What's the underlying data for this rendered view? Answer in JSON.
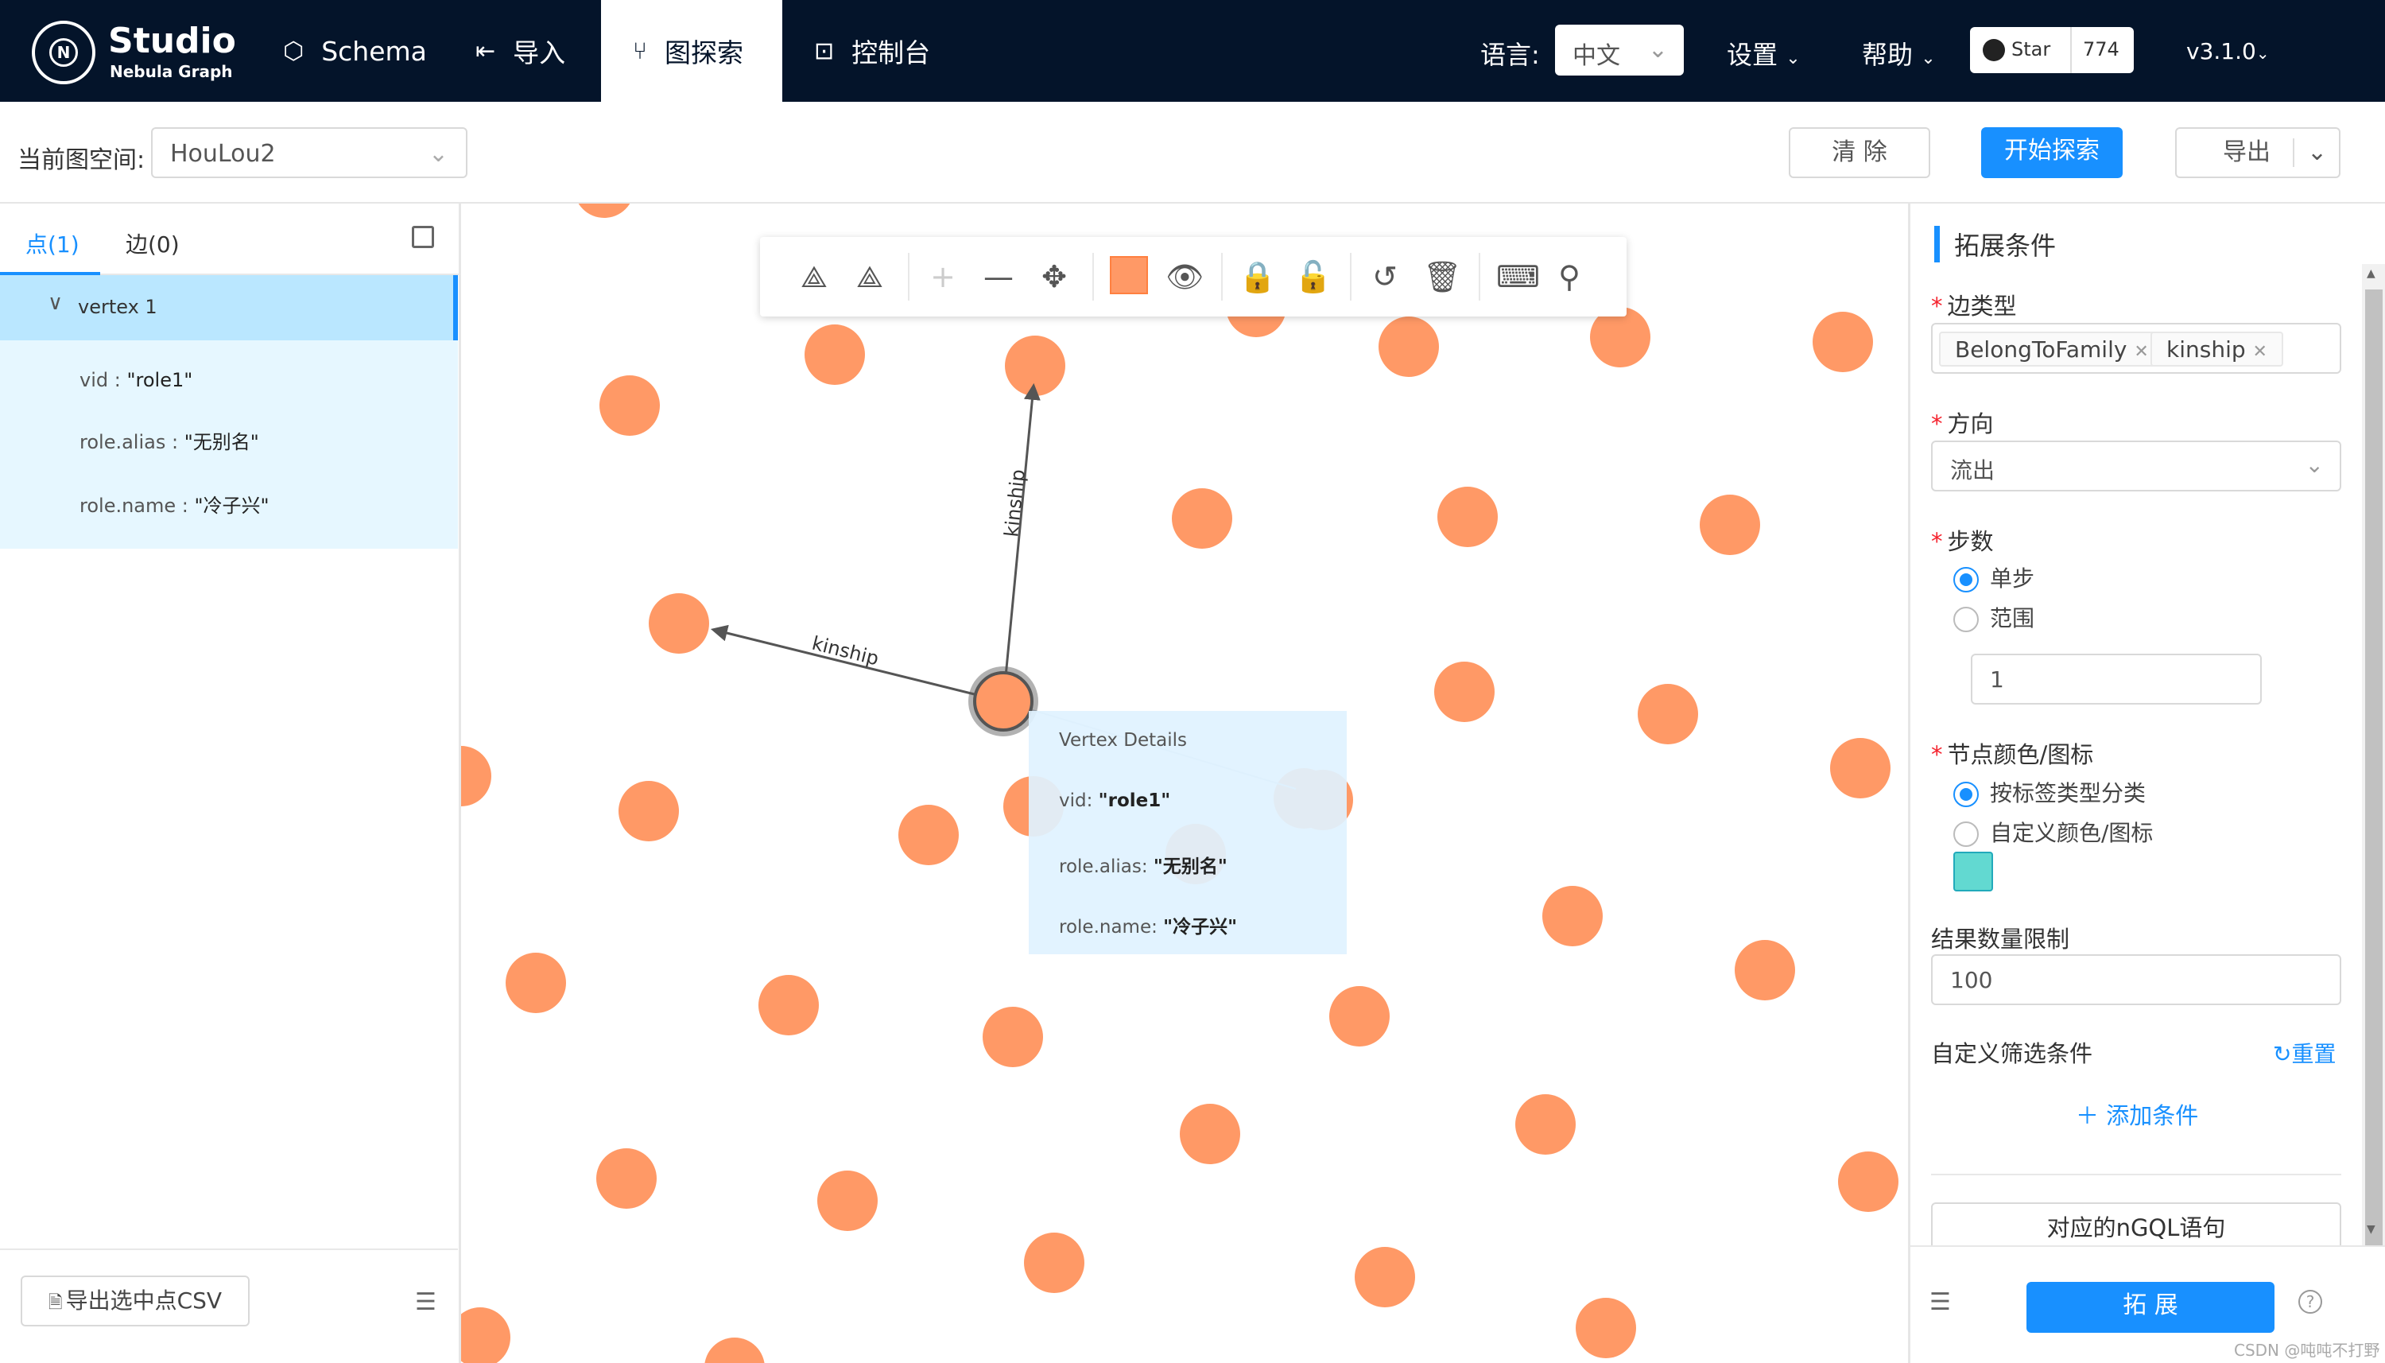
{
  "app": {
    "brand": "Studio",
    "brand_sub": "Nebula Graph",
    "logo_letter": "N"
  },
  "nav": {
    "schema": "Schema",
    "import": "导入",
    "explore": "图探索",
    "console": "控制台"
  },
  "header": {
    "lang_label": "语言:",
    "lang_value": "中文",
    "settings": "设置",
    "help": "帮助",
    "star_label": "Star",
    "star_count": "774",
    "version": "v3.1.0"
  },
  "toolbar": {
    "space_label": "当前图空间:",
    "space_value": "HouLou2",
    "clear": "清 除",
    "start": "开始探索",
    "export": "导出"
  },
  "left": {
    "tab_vertices": "点(1)",
    "tab_edges": "边(0)",
    "vertex_title": "vertex 1",
    "props": [
      {
        "key": "vid :",
        "val": "\"role1\""
      },
      {
        "key": "role.alias :",
        "val": "\"无别名\""
      },
      {
        "key": "role.name :",
        "val": "\"冷子兴\""
      }
    ],
    "export_csv": "导出选中点CSV"
  },
  "canvas": {
    "edge_label_1": "kinship",
    "edge_label_2": "kinship",
    "node_color": "#ff9966",
    "tooltip": {
      "title": "Vertex Details",
      "rows": [
        {
          "key": "vid:",
          "val": "\"role1\""
        },
        {
          "key": "role.alias:",
          "val": "\"无别名\""
        },
        {
          "key": "role.name:",
          "val": "\"冷子兴\""
        }
      ]
    }
  },
  "panel": {
    "title": "拓展条件",
    "edge_type_label": "边类型",
    "edge_types": [
      "BelongToFamily",
      "kinship"
    ],
    "direction_label": "方向",
    "direction_value": "流出",
    "steps_label": "步数",
    "step_single": "单步",
    "step_range": "范围",
    "step_value": "1",
    "color_label": "节点颜色/图标",
    "color_by_tag": "按标签类型分类",
    "color_custom": "自定义颜色/图标",
    "custom_color": "#62d9d1",
    "limit_label": "结果数量限制",
    "limit_value": "100",
    "filter_label": "自定义筛选条件",
    "reset": "重置",
    "add_condition": "添加条件",
    "ngql": "对应的nGQL语句",
    "expand": "拓 展"
  },
  "watermark": "CSDN @吨吨不打野"
}
